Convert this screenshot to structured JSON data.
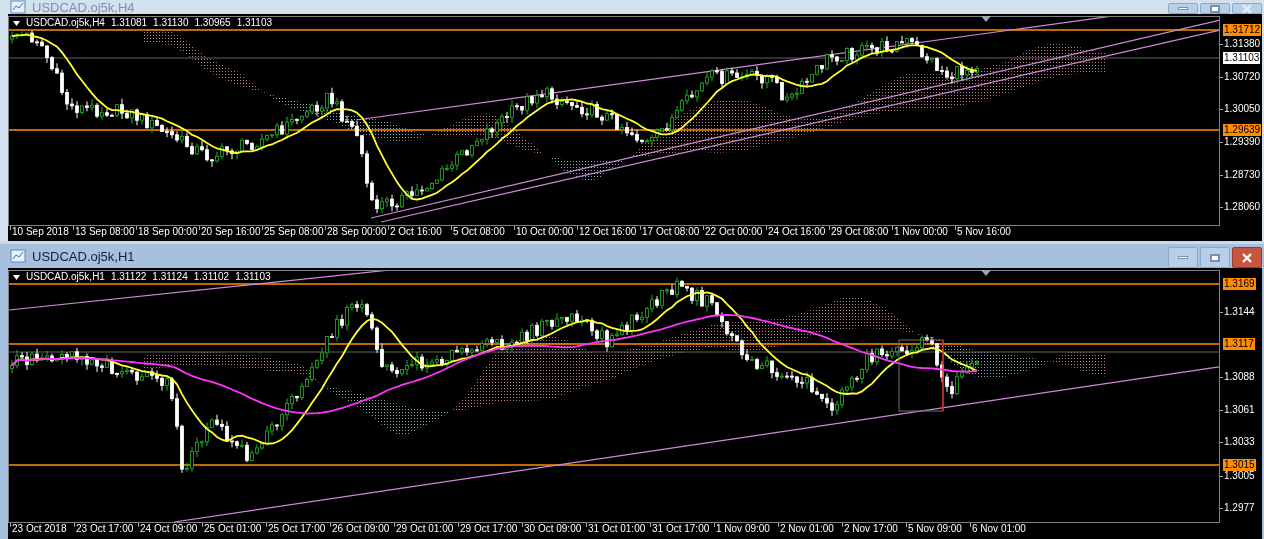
{
  "windows": [
    {
      "title": "USDCAD.oj5k,H4",
      "active": false,
      "info": {
        "symbol": "USDCAD.oj5k,H4",
        "ohlc": [
          "1.31081",
          "1.31130",
          "1.30965",
          "1.31103"
        ]
      },
      "price_axis": [
        {
          "text": "1.31712",
          "kind": "level"
        },
        {
          "text": "1.31380",
          "kind": "tick"
        },
        {
          "text": "1.31103",
          "kind": "bid"
        },
        {
          "text": "1.30720",
          "kind": "tick"
        },
        {
          "text": "1.30050",
          "kind": "tick"
        },
        {
          "text": "1.29639",
          "kind": "level"
        },
        {
          "text": "1.29390",
          "kind": "tick"
        },
        {
          "text": "1.28730",
          "kind": "tick"
        },
        {
          "text": "1.28060",
          "kind": "tick"
        }
      ],
      "time_axis": [
        "10 Sep 2018",
        "13 Sep 08:00",
        "18 Sep 00:00",
        "20 Sep 16:00",
        "25 Sep 08:00",
        "28 Sep 00:00",
        "2 Oct 16:00",
        "5 Oct 08:00",
        "10 Oct 00:00",
        "12 Oct 16:00",
        "17 Oct 08:00",
        "22 Oct 00:00",
        "24 Oct 16:00",
        "29 Oct 08:00",
        "1 Nov 00:00",
        "5 Nov 16:00"
      ]
    },
    {
      "title": "USDCAD.oj5k,H1",
      "active": true,
      "info": {
        "symbol": "USDCAD.oj5k,H1",
        "ohlc": [
          "1.31122",
          "1.31124",
          "1.31102",
          "1.31103"
        ]
      },
      "price_axis": [
        {
          "text": "1.3169",
          "kind": "level"
        },
        {
          "text": "1.3144",
          "kind": "tick"
        },
        {
          "text": "1.3117",
          "kind": "level"
        },
        {
          "text": "1.3088",
          "kind": "tick"
        },
        {
          "text": "1.3061",
          "kind": "tick"
        },
        {
          "text": "1.3033",
          "kind": "tick"
        },
        {
          "text": "1.3015",
          "kind": "level"
        },
        {
          "text": "1.3005",
          "kind": "tick"
        },
        {
          "text": "1.2977",
          "kind": "tick"
        }
      ],
      "time_axis": [
        "23 Oct 2018",
        "23 Oct 17:00",
        "24 Oct 09:00",
        "25 Oct 01:00",
        "25 Oct 17:00",
        "26 Oct 09:00",
        "29 Oct 01:00",
        "29 Oct 17:00",
        "30 Oct 09:00",
        "31 Oct 01:00",
        "31 Oct 17:00",
        "1 Nov 09:00",
        "2 Nov 01:00",
        "2 Nov 17:00",
        "5 Nov 09:00",
        "6 Nov 01:00"
      ]
    }
  ]
}
